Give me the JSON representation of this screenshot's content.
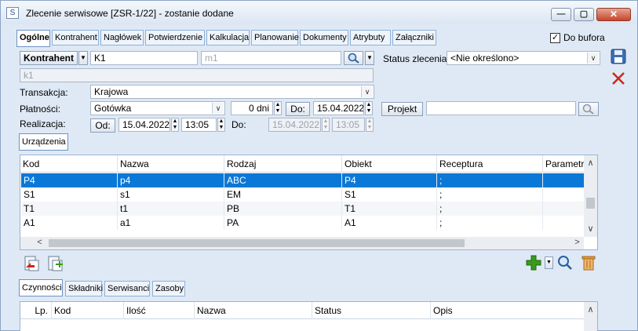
{
  "window": {
    "app_icon": "S",
    "title": "Zlecenie serwisowe [ZSR-1/22]  - zostanie dodane",
    "minimize_glyph": "—",
    "maximize_glyph": "▢",
    "close_glyph": "✕"
  },
  "tabs": [
    "Ogólne",
    "Kontrahent",
    "Nagłówek",
    "Potwierdzenie",
    "Kalkulacja",
    "Planowanie",
    "Dokumenty",
    "Atrybuty",
    "Załączniki"
  ],
  "do_bufora": {
    "label": "Do bufora",
    "checked": true,
    "mark": "✓"
  },
  "form": {
    "kontrahent_button": "Kontrahent",
    "kontrahent_value": "K1",
    "kontrahent_placeholder": "m1",
    "kontrahent_name": "k1",
    "status_label": "Status zlecenia:",
    "status_value": "<Nie określono>",
    "transakcja_label": "Transakcja:",
    "transakcja_value": "Krajowa",
    "platnosci_label": "Płatności:",
    "platnosci_value": "Gotówka",
    "dni_value": "0 dni",
    "do_button": "Do:",
    "do_date": "15.04.2022",
    "projekt_button": "Projekt",
    "projekt_value": "",
    "realizacja_label": "Realizacja:",
    "od_button": "Od:",
    "od_date": "15.04.2022",
    "od_time": "13:05",
    "do2_label": "Do:",
    "do2_date": "15.04.2022",
    "do2_time": "13:05"
  },
  "urzadzenia": {
    "tab_label": "Urządzenia",
    "columns": [
      "Kod",
      "Nazwa",
      "Rodzaj",
      "Obiekt",
      "Receptura",
      "Parametry"
    ],
    "rows": [
      [
        "P4",
        "p4",
        "ABC",
        "P4",
        ";",
        ""
      ],
      [
        "S1",
        "s1",
        "EM",
        "S1",
        ";",
        ""
      ],
      [
        "T1",
        "t1",
        "PB",
        "T1",
        ";",
        ""
      ],
      [
        "A1",
        "a1",
        "PA",
        "A1",
        ";",
        ""
      ]
    ],
    "selected_row": 0
  },
  "bottom_tabs": [
    "Czynności",
    "Składniki",
    "Serwisanci",
    "Zasoby"
  ],
  "czynnosci": {
    "columns": [
      "Lp.",
      "Kod",
      "Ilość",
      "Nazwa",
      "Status",
      "Opis"
    ]
  },
  "glyphs": {
    "arrow_down": "▼",
    "arrow_up": "▲",
    "chev_up": "∧",
    "chev_down": "∨",
    "chev_left": "<",
    "chev_right": ">"
  },
  "colors": {
    "selection": "#0a78d7",
    "tab_border": "#8fb0d6",
    "add_green": "#3a9a1e",
    "delete_red": "#d0261c"
  }
}
